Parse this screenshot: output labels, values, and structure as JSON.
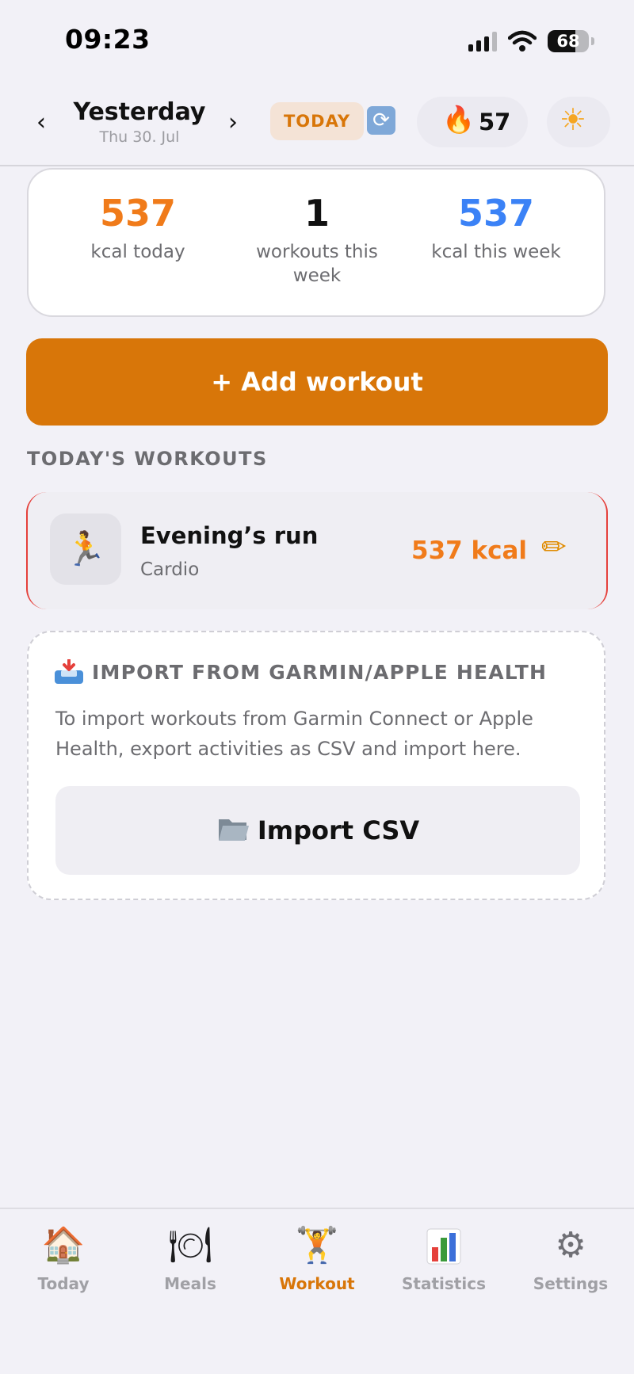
{
  "status_bar": {
    "time": "09:23",
    "battery": "68",
    "battery_level": 0.68
  },
  "header": {
    "prev_icon": "chevron-left-icon",
    "prev_glyph": "‹",
    "date_title": "Yesterday",
    "date_subtitle": "Thu 30. Jul",
    "next_icon": "chevron-right-icon",
    "next_glyph": "›",
    "today_label": "TODAY",
    "refresh_icon": "refresh-icon",
    "streak_icon": "flame-icon",
    "streak_value": "57",
    "theme_icon": "sun-icon"
  },
  "summary": {
    "kcal_today": {
      "value": "537",
      "label": "kcal today",
      "color": "#f07b1a"
    },
    "workouts_week": {
      "value": "1",
      "label": "workouts this week",
      "color": "#111111"
    },
    "kcal_week": {
      "value": "537",
      "label": "kcal this week",
      "color": "#3b82f6"
    }
  },
  "add_workout_label": "+ Add workout",
  "section_title": "TODAY'S WORKOUTS",
  "workouts": [
    {
      "icon": "runner-icon",
      "name": "Evening’s run",
      "type": "Cardio",
      "kcal": "537 kcal",
      "edit_icon": "pencil-icon"
    }
  ],
  "import": {
    "icon": "inbox-tray-icon",
    "title": "IMPORT FROM GARMIN/APPLE HEALTH",
    "description": "To import workouts from Garmin Connect or Apple Health, export activities as CSV and import here.",
    "button_label": "Import CSV",
    "button_icon": "folder-icon"
  },
  "tabs": [
    {
      "label": "Today",
      "icon": "house-icon",
      "active": false
    },
    {
      "label": "Meals",
      "icon": "plate-icon",
      "active": false
    },
    {
      "label": "Workout",
      "icon": "weightlifter-icon",
      "active": true
    },
    {
      "label": "Statistics",
      "icon": "bar-chart-icon",
      "active": false
    },
    {
      "label": "Settings",
      "icon": "gear-icon",
      "active": false
    }
  ],
  "colors": {
    "accent": "#d87609",
    "kcal_orange": "#f07b1a",
    "week_blue": "#3b82f6",
    "background": "#f2f1f7"
  }
}
